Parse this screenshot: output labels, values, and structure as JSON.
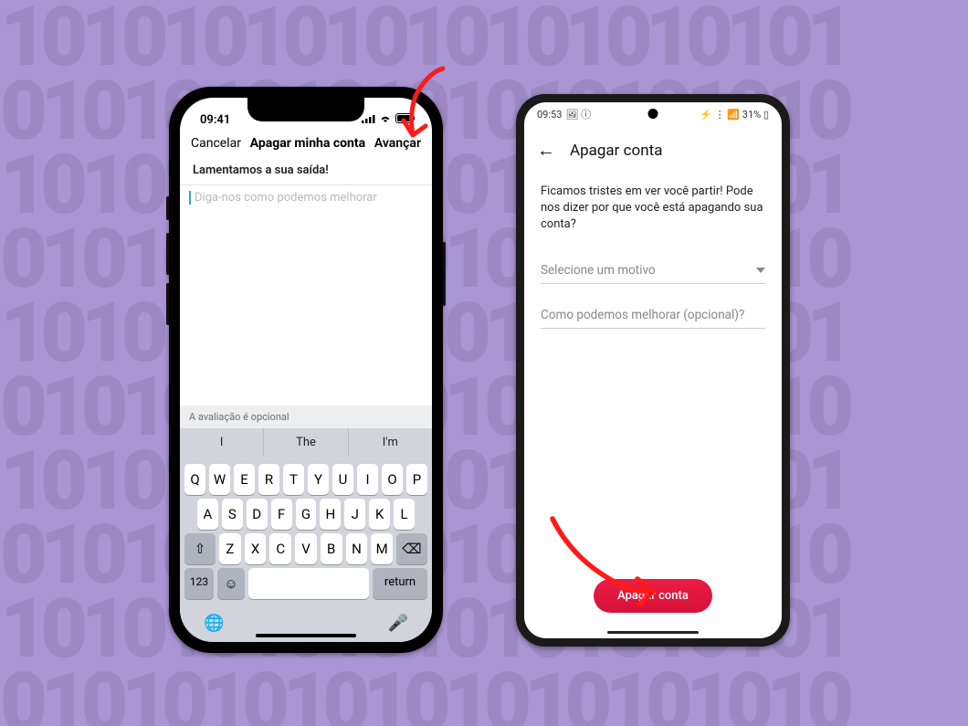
{
  "iphone": {
    "status": {
      "time": "09:41",
      "signal": "●●●",
      "wifi": "wifi",
      "battery": "batt"
    },
    "nav": {
      "cancel": "Cancelar",
      "title": "Apagar minha conta",
      "next": "Avançar"
    },
    "subtitle": "Lamentamos a sua saída!",
    "textarea_placeholder": "Diga-nos como podemos melhorar",
    "keyboard": {
      "hint": "A avaliação é opcional",
      "suggestions": [
        "I",
        "The",
        "I'm"
      ],
      "row1": [
        "Q",
        "W",
        "E",
        "R",
        "T",
        "Y",
        "U",
        "I",
        "O",
        "P"
      ],
      "row2": [
        "A",
        "S",
        "D",
        "F",
        "G",
        "H",
        "J",
        "K",
        "L"
      ],
      "row3_keys": [
        "Z",
        "X",
        "C",
        "V",
        "B",
        "N",
        "M"
      ],
      "shift_label": "⇧",
      "backspace_label": "⌫",
      "numbers_label": "123",
      "emoji_label": "☺",
      "return_label": "return",
      "globe_label": "🌐",
      "mic_label": "🎤"
    }
  },
  "android": {
    "status": {
      "time": "09:53",
      "icons_left": "🖼 ⓘ",
      "icons_right": "⚡ ⋮ 📶 31% ▯"
    },
    "nav": {
      "back_icon": "←",
      "title": "Apagar conta"
    },
    "body_text": "Ficamos tristes em ver você partir! Pode nos dizer por que você está apagando sua conta?",
    "select_placeholder": "Selecione um motivo",
    "input_placeholder": "Como podemos melhorar (opcional)?",
    "delete_button": "Apagar conta"
  },
  "bg_pattern_text": "101010101010101010101\n010101010101010101010\n101010101010101010101\n010101010101010101010\n101010101010101010101\n010101010101010101010\n101010101010101010101\n010101010101010101010\n101010101010101010101\n010101010101010101010"
}
